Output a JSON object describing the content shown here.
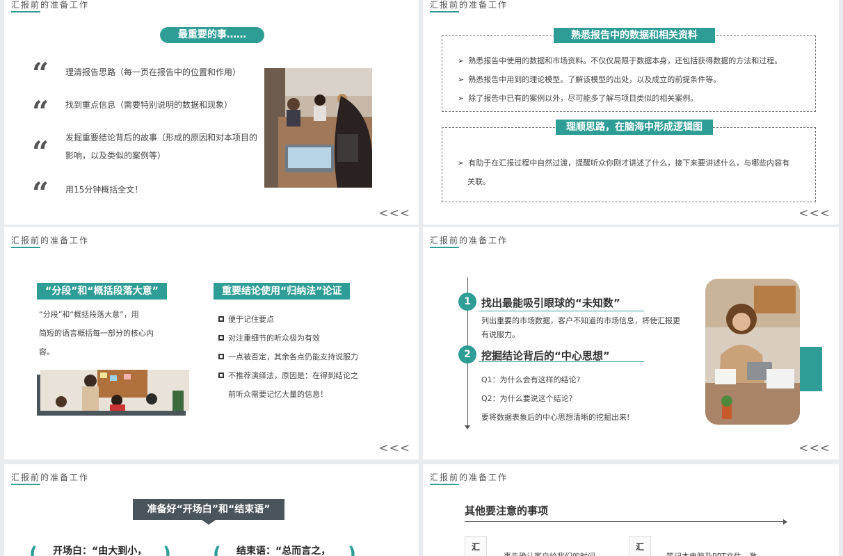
{
  "common": {
    "section_title": "汇报前的准备工作",
    "nav_arrows": "<<<"
  },
  "slide1": {
    "pill": "最重要的事……",
    "items": [
      "理清报告思路（每一页在报告中的位置和作用）",
      "找到重点信息（需要特别说明的数据和现象）",
      "发掘重要结论背后的故事（形成的原因和对本项目的影响，以及类似的案例等）",
      "用15分钟概括全文！"
    ]
  },
  "slide2": {
    "box1_title": "熟悉报告中的数据和相关资料",
    "box1_bullets": [
      "熟悉报告中使用的数据和市场资料。不仅仅局限于数据本身，还包括获得数据的方法和过程。",
      "熟悉报告中用到的理论模型。了解该模型的出处，以及成立的前提条件等。",
      "除了报告中已有的案例以外，尽可能多了解与项目类似的相关案例。"
    ],
    "box2_title": "理顺思路，在脑海中形成逻辑图",
    "box2_bullet_line1": "有助于在汇报过程中自然过渡，提醒听众你刚才讲述了什么，接下来要讲述什么，与哪些内容有",
    "box2_bullet_line2": "关联。",
    "bullet_marker": "➢"
  },
  "slide3": {
    "left_tag": "“分段”和“概括段落大意”",
    "left_text_lines": [
      "“分段”和“概括段落大意”，用",
      "简短的语言概括每一部分的核心内",
      "容。"
    ],
    "right_tag": "重要结论使用“归纳法”论证",
    "right_items": [
      "便于记住要点",
      "对注重细节的听众极为有效",
      "一点被否定，其余各点仍能支持说服力",
      "不推荐演绎法，原因是：在得到结论之"
    ],
    "right_item_cont": "前听众需要记忆大量的信息！"
  },
  "slide4": {
    "item1_num": "1",
    "item1_title": "找出最能吸引眼球的“未知数”",
    "item1_text_line1": "列出重要的市场数据，客户不知道的市场信息，将使汇报更",
    "item1_text_line2": "有说服力。",
    "item2_num": "2",
    "item2_title": "挖掘结论背后的“中心思想”",
    "item2_lines": [
      "Q1：为什么会有这样的结论?",
      "Q2：为什么要说这个结论?",
      "要将数据表象后的中心思想清晰的挖掘出来!"
    ]
  },
  "slide5": {
    "banner": "准备好“开场白”和“结束语”",
    "left_sub": "开场白：“由大到小，",
    "right_sub": "结束语：“总而言之，"
  },
  "slide6": {
    "title": "其他要注意的事项",
    "box_char": "汇",
    "left_text": "事先确认客户给我们的时间",
    "right_text": "笔记本电脑及PPT文件，激"
  },
  "colors": {
    "accent": "#2e9d96",
    "dark_banner": "#4a545b"
  },
  "icons": {
    "quote": "“",
    "checkbox": "checkbox-square-icon"
  }
}
